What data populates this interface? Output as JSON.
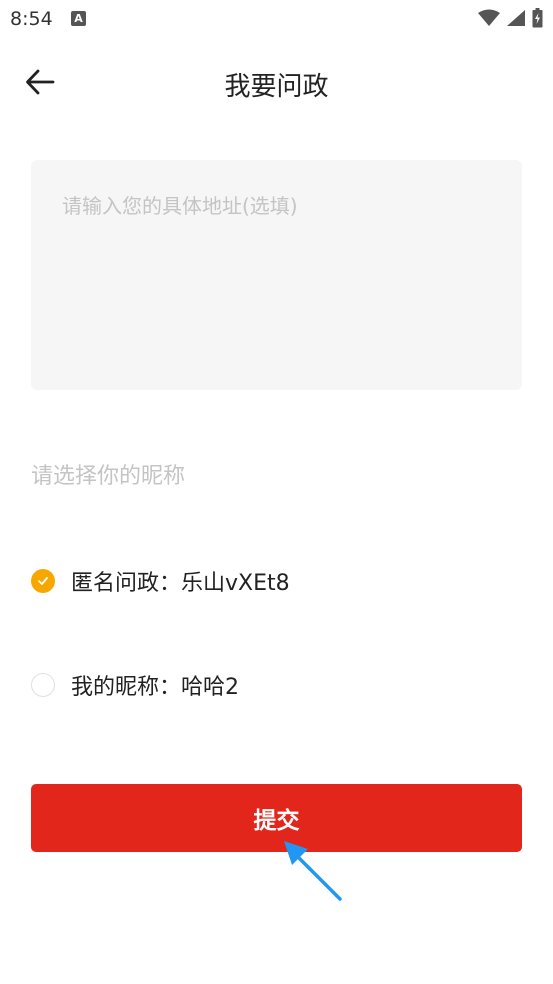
{
  "status_bar": {
    "time": "8:54",
    "app_icon_letter": "A"
  },
  "header": {
    "title": "我要问政"
  },
  "form": {
    "address_placeholder": "请输入您的具体地址(选填)",
    "address_value": "",
    "nickname_prompt": "请选择你的昵称"
  },
  "options": [
    {
      "label": "匿名问政：乐山vXEt8",
      "selected": true
    },
    {
      "label": "我的昵称：哈哈2",
      "selected": false
    }
  ],
  "submit_label": "提交",
  "colors": {
    "accent": "#f6a800",
    "primary": "#e3261b",
    "pointer": "#2196f3"
  }
}
